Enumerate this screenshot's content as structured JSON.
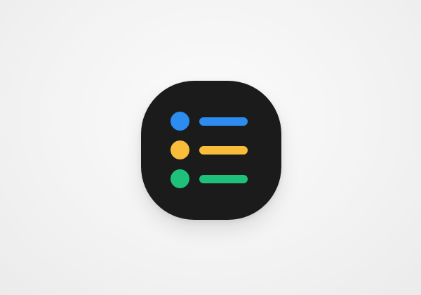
{
  "app_icon": {
    "name": "list-app-icon",
    "background_color": "#1b1b1c",
    "rows": [
      {
        "icon": "bullet-dot",
        "color": "#2d8cf0"
      },
      {
        "icon": "bullet-dot",
        "color": "#f9bd39"
      },
      {
        "icon": "bullet-dot",
        "color": "#1fc07a"
      }
    ]
  }
}
